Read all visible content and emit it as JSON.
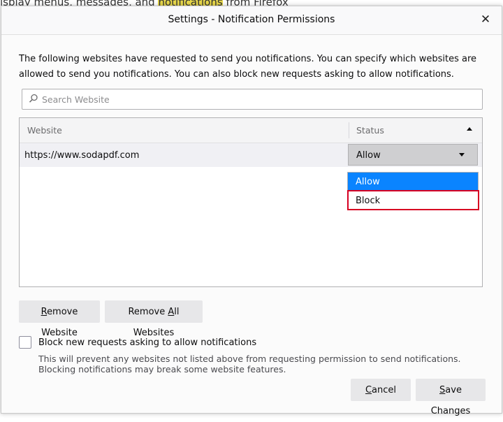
{
  "background": {
    "text_before": "isplay menus, messages, and ",
    "text_highlight": "notifications",
    "text_after": " from Firefox"
  },
  "dialog": {
    "title": "Settings - Notification Permissions",
    "close_glyph": "✕",
    "description": "The following websites have requested to send you notifications. You can specify which websites are allowed to send you notifications. You can also block new requests asking to allow notifications."
  },
  "search": {
    "placeholder": "Search Website",
    "value": ""
  },
  "table": {
    "headers": {
      "website": "Website",
      "status": "Status"
    },
    "rows": [
      {
        "website": "https://www.sodapdf.com",
        "status": "Allow"
      }
    ],
    "dropdown_options": [
      "Allow",
      "Block"
    ]
  },
  "buttons": {
    "remove_website_accel": "R",
    "remove_website_rest": "emove Website",
    "remove_all_pre": "Remove ",
    "remove_all_accel": "A",
    "remove_all_rest": "ll Websites",
    "cancel_accel": "C",
    "cancel_rest": "ancel",
    "save_pre": "",
    "save_accel": "S",
    "save_rest": "ave Changes"
  },
  "block_new": {
    "label": "Block new requests asking to allow notifications",
    "checked": false,
    "help": "This will prevent any websites not listed above from requesting permission to send notifications. Blocking notifications may break some website features."
  },
  "colors": {
    "accent": "#0a84ff",
    "highlight_border": "#d70022"
  }
}
